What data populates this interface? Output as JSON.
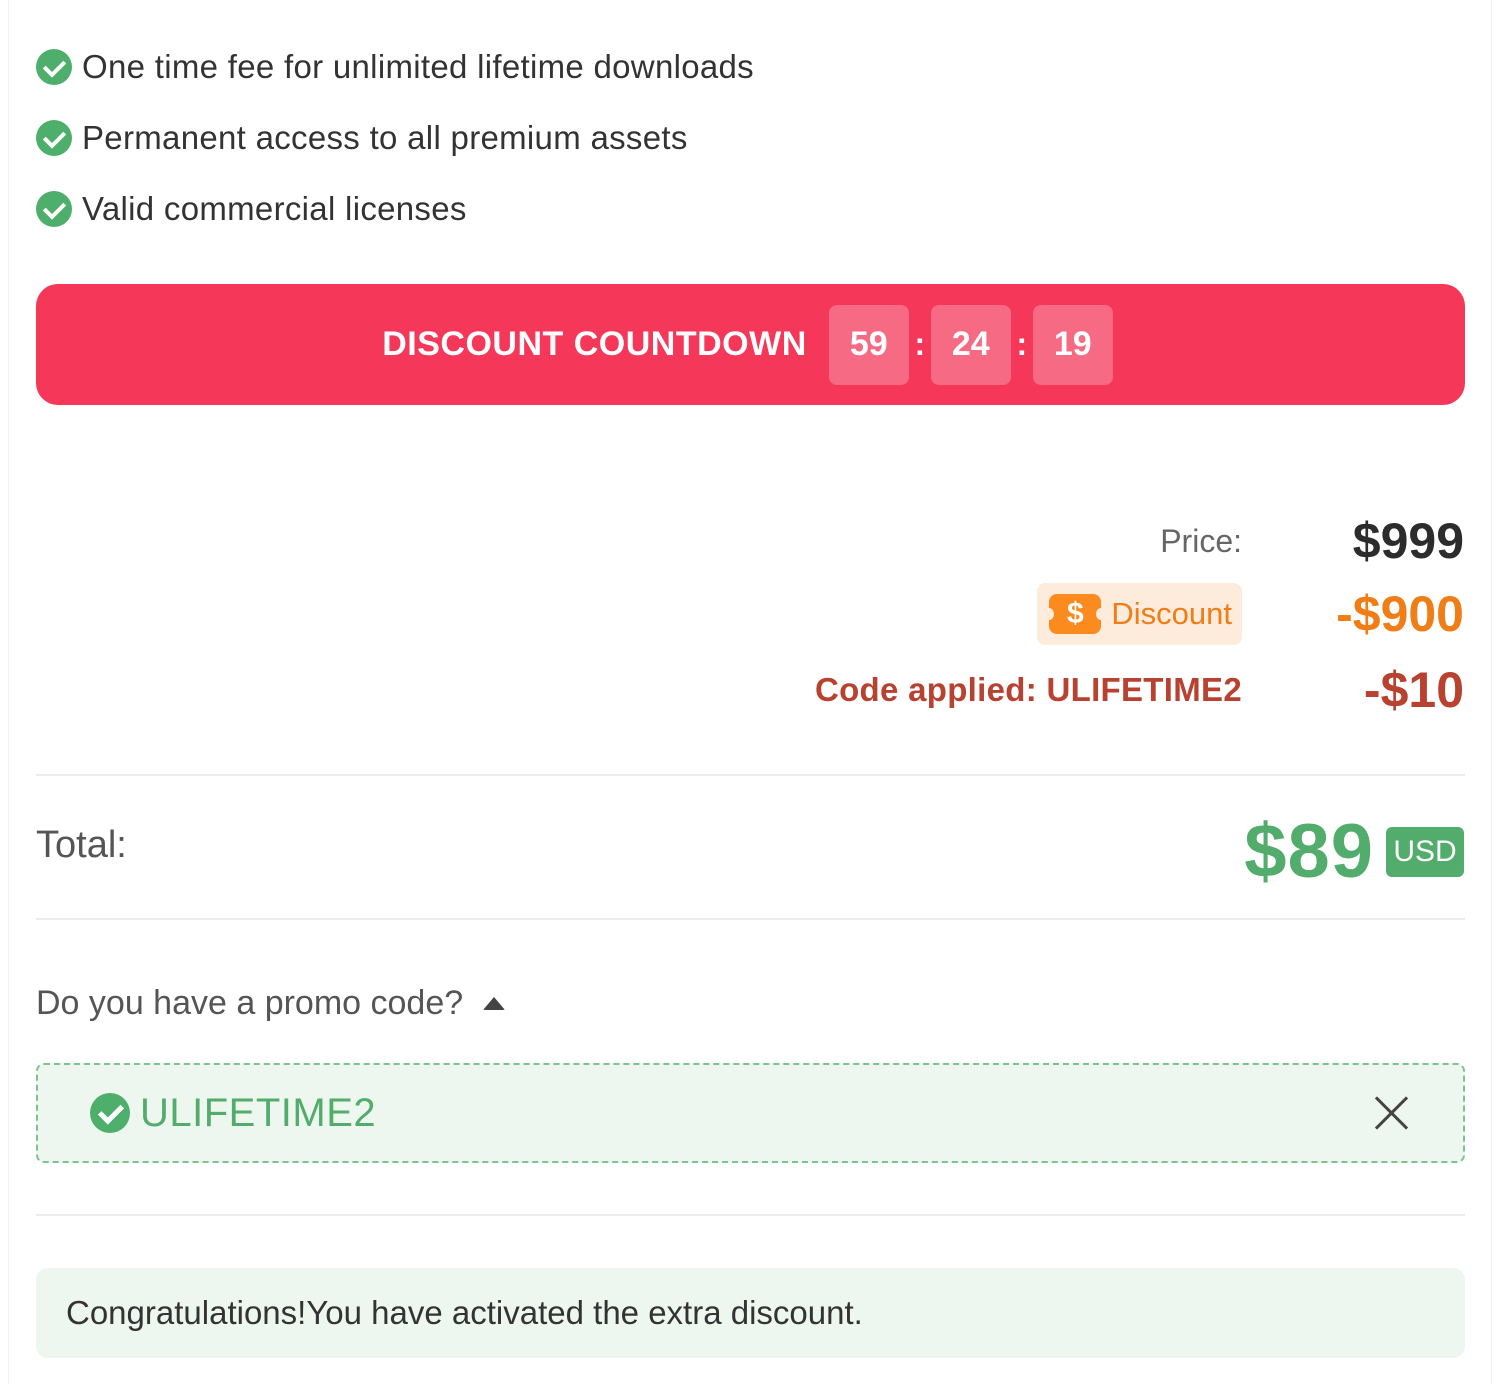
{
  "features": [
    {
      "text": "One time fee for unlimited lifetime downloads",
      "icon": "check-circle-icon"
    },
    {
      "text": "Permanent access to all premium assets",
      "icon": "check-circle-icon"
    },
    {
      "text": "Valid commercial licenses",
      "icon": "check-circle-icon"
    }
  ],
  "countdown": {
    "title": "DISCOUNT COUNTDOWN",
    "hours": "59",
    "minutes": "24",
    "seconds": "19",
    "separator": ":",
    "color": "#f5385a"
  },
  "pricing": {
    "price_label": "Price:",
    "price_value": "$999",
    "discount_icon_text": "$",
    "discount_label": "Discount",
    "discount_value": "-$900",
    "code_label": "Code applied: ULIFETIME2",
    "code_value": "-$10"
  },
  "total": {
    "label": "Total:",
    "value": "$89",
    "currency": "USD",
    "color": "#52ac6b"
  },
  "promo": {
    "question": "Do you have a promo code?",
    "caret_icon": "caret-up-icon",
    "applied_code": "ULIFETIME2",
    "close_icon": "close-icon"
  },
  "message": {
    "text": "Congratulations!You have activated the extra discount."
  }
}
